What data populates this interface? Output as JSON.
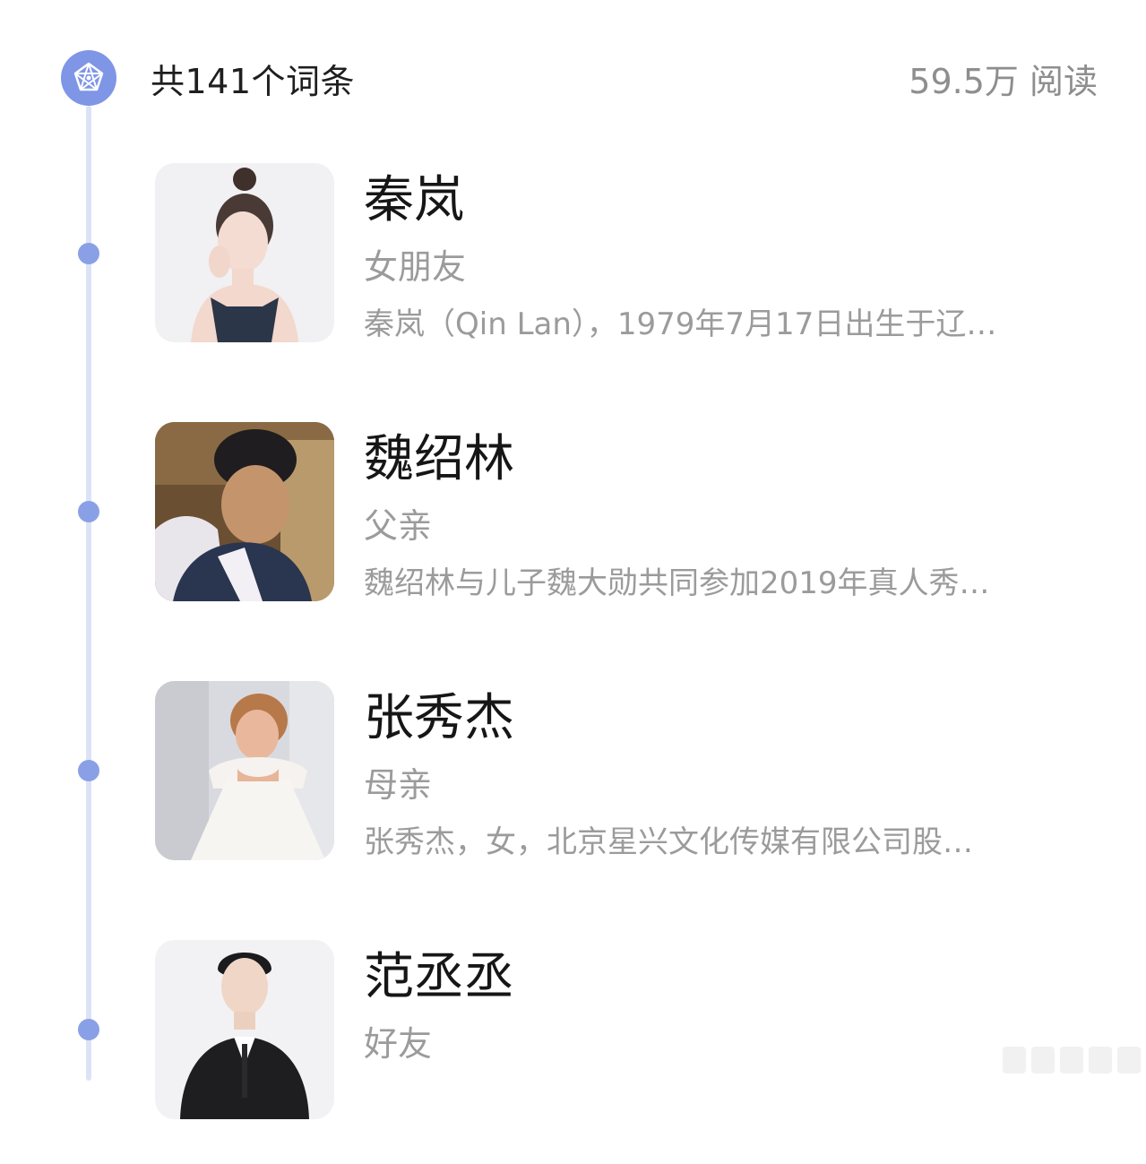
{
  "header": {
    "count_label": "共141个词条",
    "reads_label": "59.5万 阅读",
    "logo_icon": "pentagram-network-icon"
  },
  "entries": [
    {
      "name": "秦岚",
      "relation": "女朋友",
      "description": "秦岚（Qin Lan），1979年7月17日出生于辽…",
      "avatar_icon": "person-photo"
    },
    {
      "name": "魏绍林",
      "relation": "父亲",
      "description": "魏绍林与儿子魏大勋共同参加2019年真人秀…",
      "avatar_icon": "person-photo"
    },
    {
      "name": "张秀杰",
      "relation": "母亲",
      "description": "张秀杰，女，北京星兴文化传媒有限公司股…",
      "avatar_icon": "person-photo"
    },
    {
      "name": "范丞丞",
      "relation": "好友",
      "description": "",
      "avatar_icon": "person-photo"
    }
  ],
  "colors": {
    "accent": "#7f95e6",
    "timeline": "#dce3f6",
    "primary_text": "#161616",
    "secondary_text": "#9b9b9b"
  }
}
